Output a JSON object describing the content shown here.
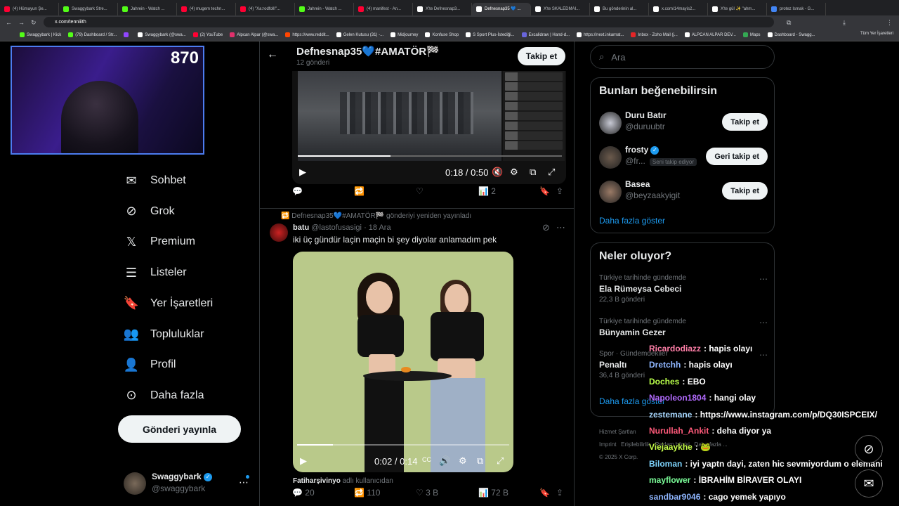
{
  "browser": {
    "tabs": [
      {
        "label": "(4) Hümayun Şe...",
        "color": "#ff0033"
      },
      {
        "label": "Swaggybark Stre...",
        "color": "#53fc18"
      },
      {
        "label": "Jahrein - Watch ...",
        "color": "#53fc18"
      },
      {
        "label": "(4) mugem techn...",
        "color": "#ff0033"
      },
      {
        "label": "(4) \"Xa:rodfolll\"...",
        "color": "#ff0033"
      },
      {
        "label": "Jahrein - Watch ...",
        "color": "#53fc18"
      },
      {
        "label": "(4) manifest - An...",
        "color": "#ff0033"
      },
      {
        "label": "X'te Defnesnap3...",
        "color": "#ffffff"
      },
      {
        "label": "Defnesnap35 💙 ...",
        "color": "#ffffff",
        "active": true
      },
      {
        "label": "X'te SKALEDMAI...",
        "color": "#ffffff"
      },
      {
        "label": "Bu gönderinin al...",
        "color": "#ffffff"
      },
      {
        "label": "x.com/14mayis2...",
        "color": "#ffffff"
      },
      {
        "label": "X'te gül ✨ \"ahm...",
        "color": "#ffffff"
      },
      {
        "label": "protez Ismak - G...",
        "color": "#4285f4"
      }
    ],
    "url": "x.com/tenniiith",
    "bookmarks": [
      {
        "label": "Swaggybark | Kick",
        "color": "#53fc18"
      },
      {
        "label": "(79) Dashboard / Str...",
        "color": "#53fc18"
      },
      {
        "label": "",
        "color": "#9146ff"
      },
      {
        "label": "Swaggybark (@swa...",
        "color": "#ffffff"
      },
      {
        "label": "(2) YouTube",
        "color": "#ff0033"
      },
      {
        "label": "Alpcan Alpar (@swa...",
        "color": "#e1306c"
      },
      {
        "label": "https://www.reddit...",
        "color": "#ff4500"
      },
      {
        "label": "Gelen Kutusu (31) -...",
        "color": "#ffffff"
      },
      {
        "label": "Midjourney",
        "color": "#ffffff"
      },
      {
        "label": "Konfuse Shop",
        "color": "#ffffff"
      },
      {
        "label": "S Sport Plus-İstediği...",
        "color": "#ffffff"
      },
      {
        "label": "Excalidraw | Hand-d...",
        "color": "#6965db"
      },
      {
        "label": "https://next.inkarnat...",
        "color": "#ffffff"
      },
      {
        "label": "Inbox - Zoho Mail (j...",
        "color": "#e42527"
      },
      {
        "label": "ALPCAN ALPAR DEV...",
        "color": "#ffffff"
      },
      {
        "label": "Maps",
        "color": "#34a853"
      },
      {
        "label": "Dashboard - Swagg...",
        "color": "#ffffff"
      }
    ],
    "all_bookmarks": "Tüm Yer İşaretleri"
  },
  "stream": {
    "viewer_count": "870"
  },
  "nav": {
    "items": [
      {
        "label": "Sohbet",
        "icon": "mail-icon"
      },
      {
        "label": "Grok",
        "icon": "grok-icon"
      },
      {
        "label": "Premium",
        "icon": "x-icon"
      },
      {
        "label": "Listeler",
        "icon": "list-icon"
      },
      {
        "label": "Yer İşaretleri",
        "icon": "bookmark-icon"
      },
      {
        "label": "Topluluklar",
        "icon": "people-icon"
      },
      {
        "label": "Profil",
        "icon": "person-icon"
      },
      {
        "label": "Daha fazla",
        "icon": "more-circle-icon"
      }
    ],
    "post_button": "Gönderi yayınla",
    "account": {
      "name": "Swaggybark",
      "handle": "@swaggybark"
    }
  },
  "profile_header": {
    "name": "Defnesnap35💙#AMATÖR🏁",
    "posts": "12 gönderi",
    "follow": "Takip et"
  },
  "post1": {
    "video_time": "0:18 / 0:50",
    "actions": {
      "views": "2"
    }
  },
  "post2": {
    "repost_note": "Defnesnap35💙#AMATÖR🏁 gönderiyi yeniden yayınladı",
    "author": "batu",
    "handle": "@lastofusasigi",
    "date": "· 18 Ara",
    "text": "iki üç gündür laçin maçin bi şey diyolar anlamadım pek",
    "video_time": "0:02 / 0:14",
    "tagged_user": "Fatiharşivinyo",
    "tagged_suffix": "adlı kullanıcıdan",
    "actions": {
      "replies": "20",
      "reposts": "110",
      "likes": "3 B",
      "views": "72 B"
    }
  },
  "search": {
    "placeholder": "Ara"
  },
  "suggestions": {
    "title": "Bunları beğenebilirsin",
    "users": [
      {
        "name": "Duru Batır",
        "handle": "@duruubtr",
        "button": "Takip et",
        "avatar_color": "#c7c9d4"
      },
      {
        "name": "frosty",
        "handle": "@fr...",
        "badge": "Seni takip ediyor",
        "button": "Geri takip et",
        "avatar_color": "#6b5a4c",
        "verified": true
      },
      {
        "name": "Basea",
        "handle": "@beyzaakyigit",
        "button": "Takip et",
        "avatar_color": "#9a7a66"
      }
    ],
    "show_more": "Daha fazla göster"
  },
  "trends": {
    "title": "Neler oluyor?",
    "items": [
      {
        "context": "Türkiye tarihinde gündemde",
        "topic": "Ela Rümeysa Cebeci",
        "posts": "22,3 B gönderi"
      },
      {
        "context": "Türkiye tarihinde gündemde",
        "topic": "Bünyamin Gezer",
        "posts": ""
      },
      {
        "context": "Spor · Gündemdekiler",
        "topic": "Penaltı",
        "posts": "36,4 B gönderi"
      }
    ],
    "show_more": "Daha fazla göster"
  },
  "footer": {
    "links": [
      "Hizmet Şartları",
      "Imprint",
      "Erişilebilirlik",
      "Reklam bilgisi",
      "Daha fazla ..."
    ],
    "copyright": "© 2025 X Corp."
  },
  "chat": [
    {
      "user": "Ricardodiazz",
      "msg": ": hapis olayı",
      "color": "#ff7fa8"
    },
    {
      "user": "Dretchh",
      "msg": ": hapis olayı",
      "color": "#8fb6ff"
    },
    {
      "user": "Doches",
      "msg": ": EBO",
      "color": "#b9ff4a"
    },
    {
      "user": "Napoleon1804",
      "msg": ": hangi olay",
      "color": "#b36bff"
    },
    {
      "user": "zestemane",
      "msg": ": https://www.instagram.com/p/DQ30ISPCEIX/",
      "color": "#a8d8ff"
    },
    {
      "user": "Nurullah_Ankit",
      "msg": ": deha diyor ya",
      "color": "#ff5a7a"
    },
    {
      "user": "Viejaaykhe",
      "msg": ": 🐸",
      "color": "#c6ff4a"
    },
    {
      "user": "Biloman",
      "msg": ": iyi yaptn dayi, zaten hic sevmiyordum o elemani",
      "color": "#7dd3fc"
    },
    {
      "user": "mayflower",
      "msg": ": İBRAHİM BİRAVER OLAYI",
      "color": "#7cff9a"
    },
    {
      "user": "sandbar9046",
      "msg": ": cago yemek yapıyo",
      "color": "#8fb6ff"
    }
  ]
}
